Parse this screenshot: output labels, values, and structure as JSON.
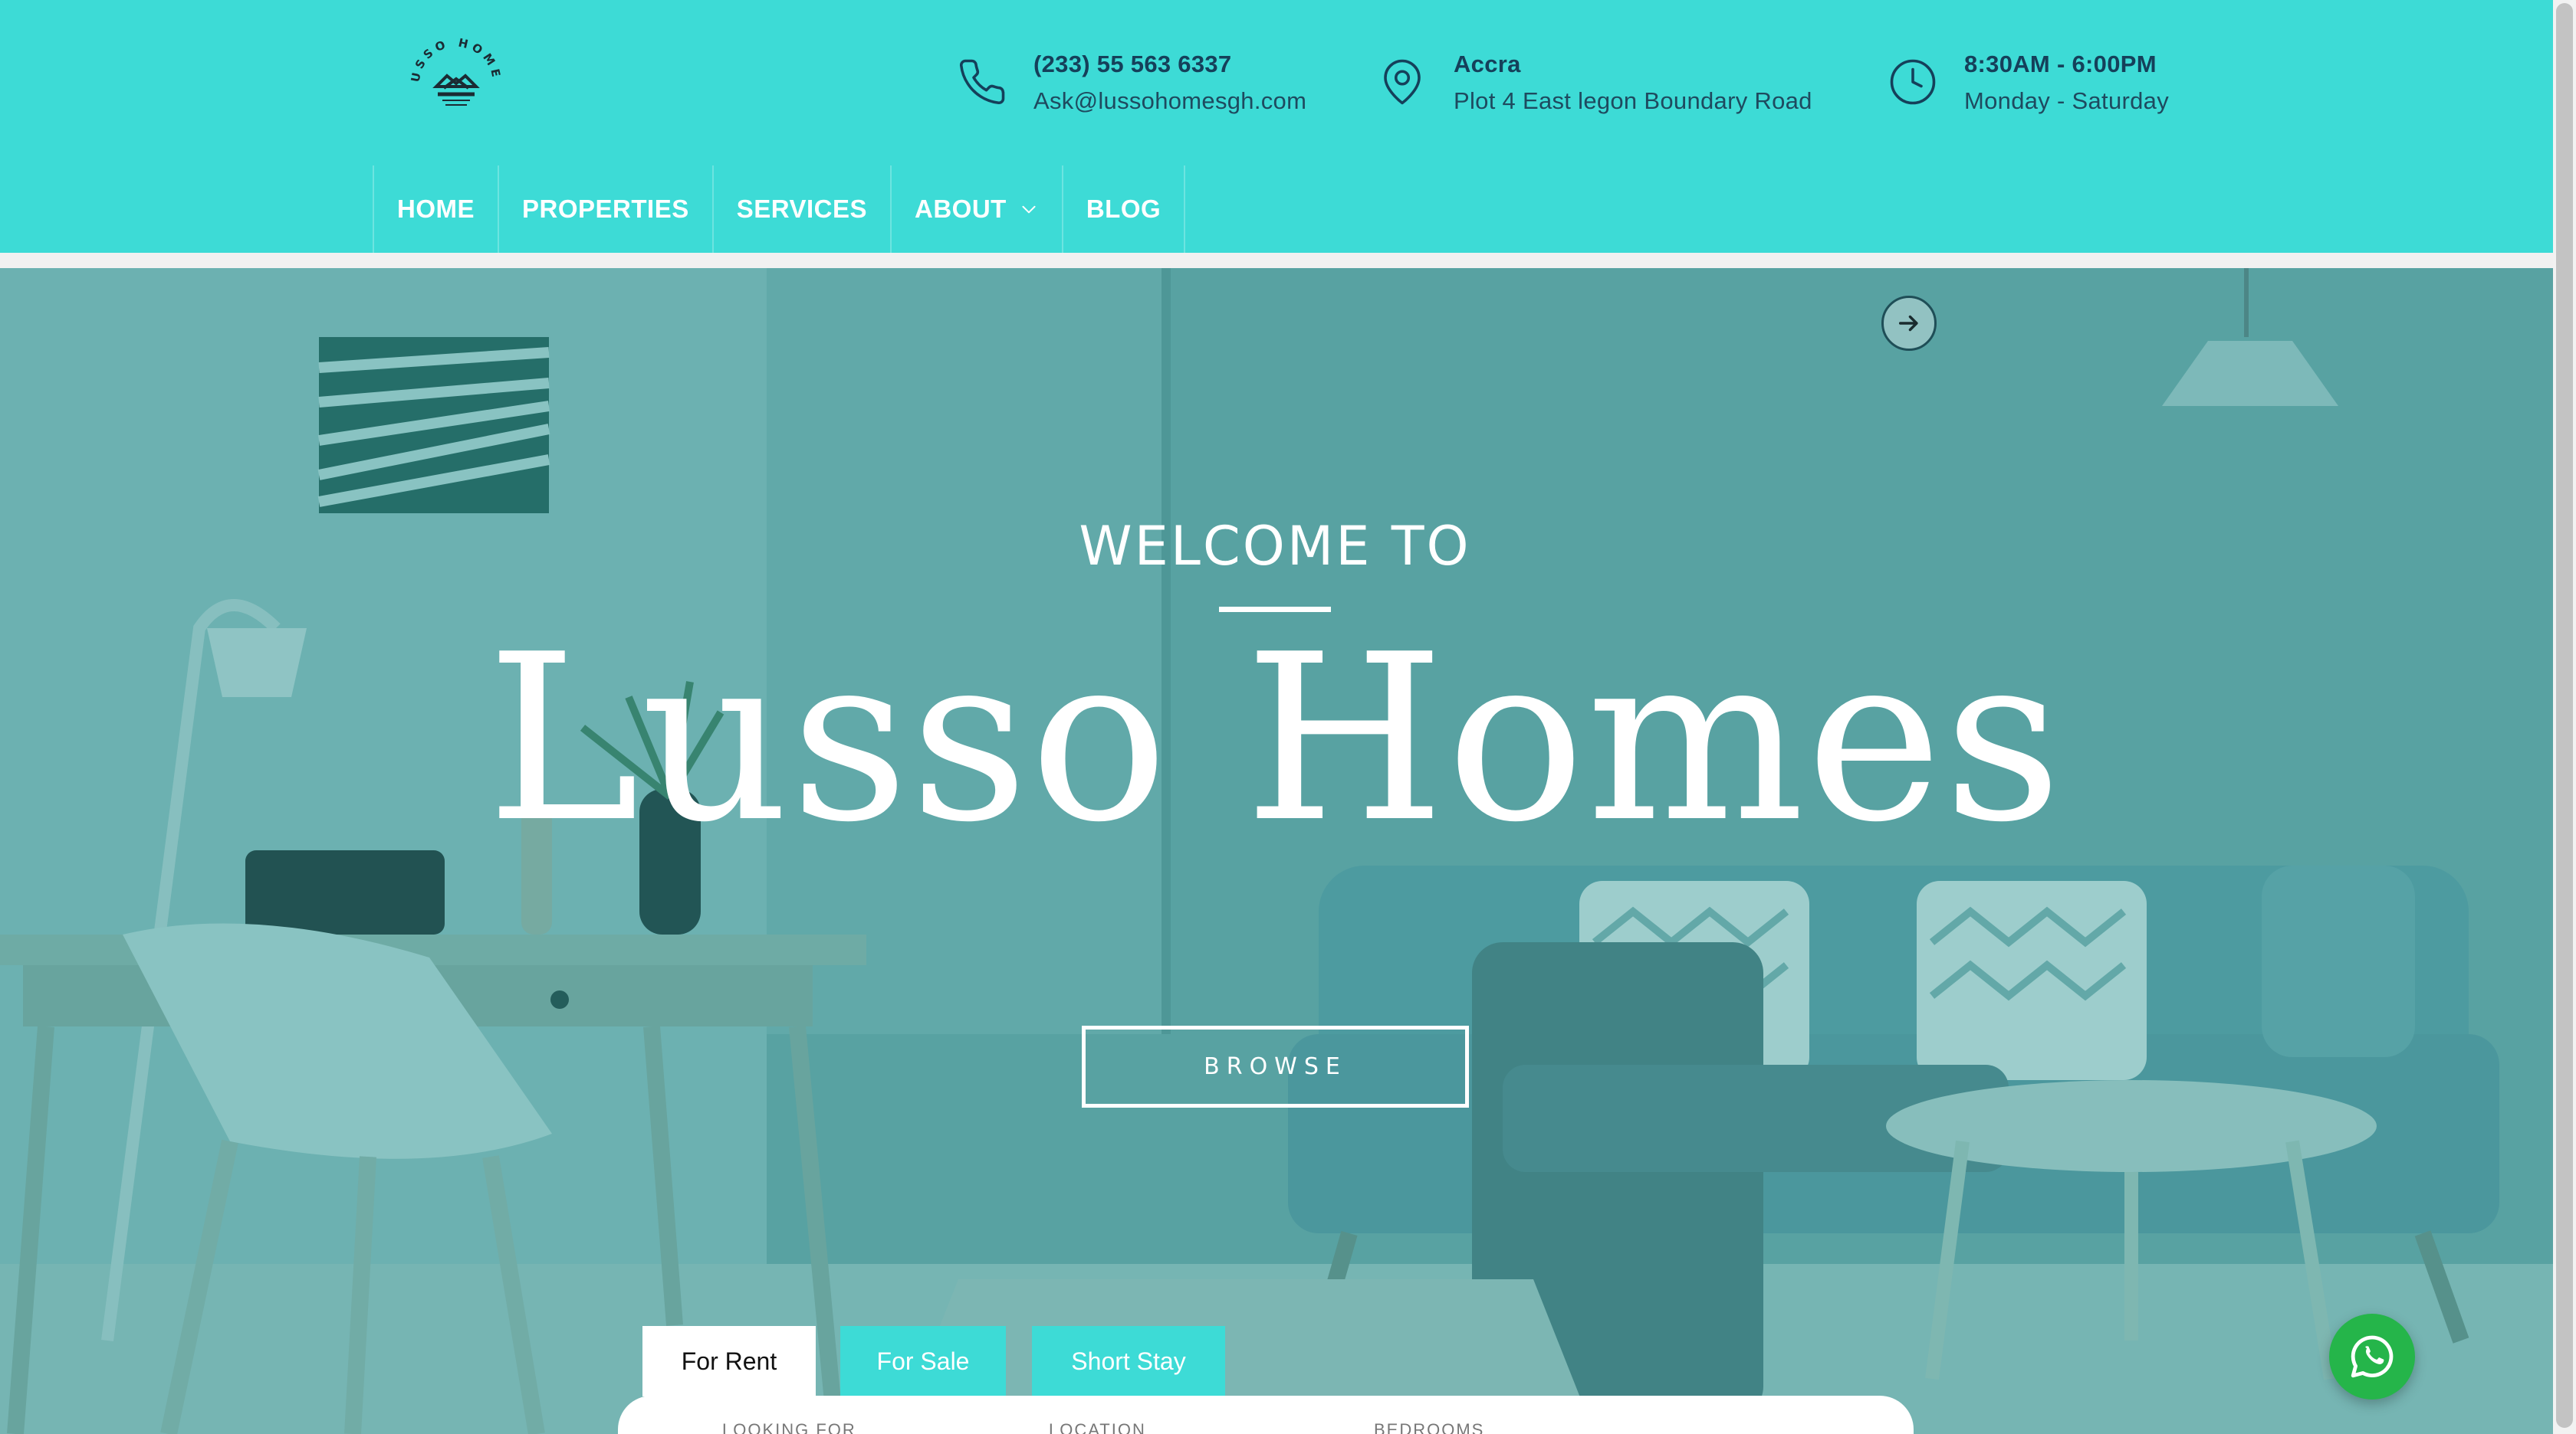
{
  "header": {
    "logo": {
      "alt": "LUSSO HOMES",
      "ring_text": "LUSSO HOMES"
    },
    "contacts": {
      "phone": {
        "icon": "phone-icon",
        "line1": "(233) 55 563 6337",
        "line2": "Ask@lussohomesgh.com"
      },
      "location": {
        "icon": "map-pin-icon",
        "line1": "Accra",
        "line2": "Plot 4 East legon Boundary Road"
      },
      "hours": {
        "icon": "clock-icon",
        "line1": "8:30AM - 6:00PM",
        "line2": "Monday - Saturday"
      }
    }
  },
  "nav": {
    "items": [
      {
        "label": "HOME"
      },
      {
        "label": "PROPERTIES"
      },
      {
        "label": "SERVICES"
      },
      {
        "label": "ABOUT",
        "icon": "chevron-down-icon"
      },
      {
        "label": "BLOG"
      }
    ]
  },
  "hero": {
    "welcome": "WELCOME TO",
    "brand": "Lusso Homes",
    "browse_label": "BROWSE",
    "slider_next_icon": "arrow-right-icon"
  },
  "search": {
    "tabs": [
      {
        "label": "For Rent",
        "active": true
      },
      {
        "label": "For Sale",
        "active": false
      },
      {
        "label": "Short Stay",
        "active": false
      }
    ],
    "fields": {
      "looking_for": "LOOKING FOR",
      "location": "LOCATION",
      "bedrooms": "BEDROOMS"
    }
  },
  "whatsapp": {
    "icon": "whatsapp-icon"
  },
  "colors": {
    "header_bg": "#3ddbd6",
    "header_text_dark": "#15405a",
    "hero_overlay": "#309694",
    "whatsapp_green": "#25b54a",
    "white": "#ffffff"
  }
}
